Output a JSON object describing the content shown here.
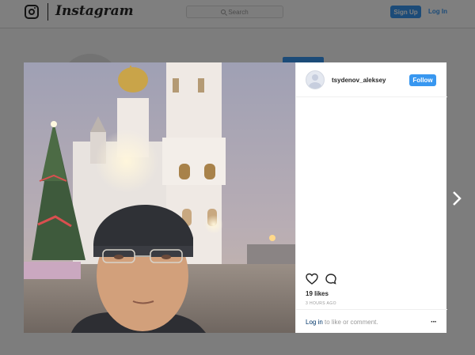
{
  "app": {
    "wordmark": "Instagram"
  },
  "header": {
    "search_placeholder": "Search",
    "signup_label": "Sign Up",
    "login_label": "Log In"
  },
  "post": {
    "username": "tsydenov_aleksey",
    "follow_label": "Follow",
    "likes": "19 likes",
    "time": "3 HOURS AGO",
    "comment_login": "Log in",
    "comment_rest": " to like or comment.",
    "more": "···"
  },
  "icons": {
    "heart": "heart-icon",
    "comment": "comment-icon",
    "next": "chevron-right-icon",
    "logo": "instagram-logo-icon"
  },
  "colors": {
    "accent": "#3897f0",
    "text": "#262626",
    "muted": "#999999",
    "overlay": "rgba(0,0,0,0.5)"
  }
}
